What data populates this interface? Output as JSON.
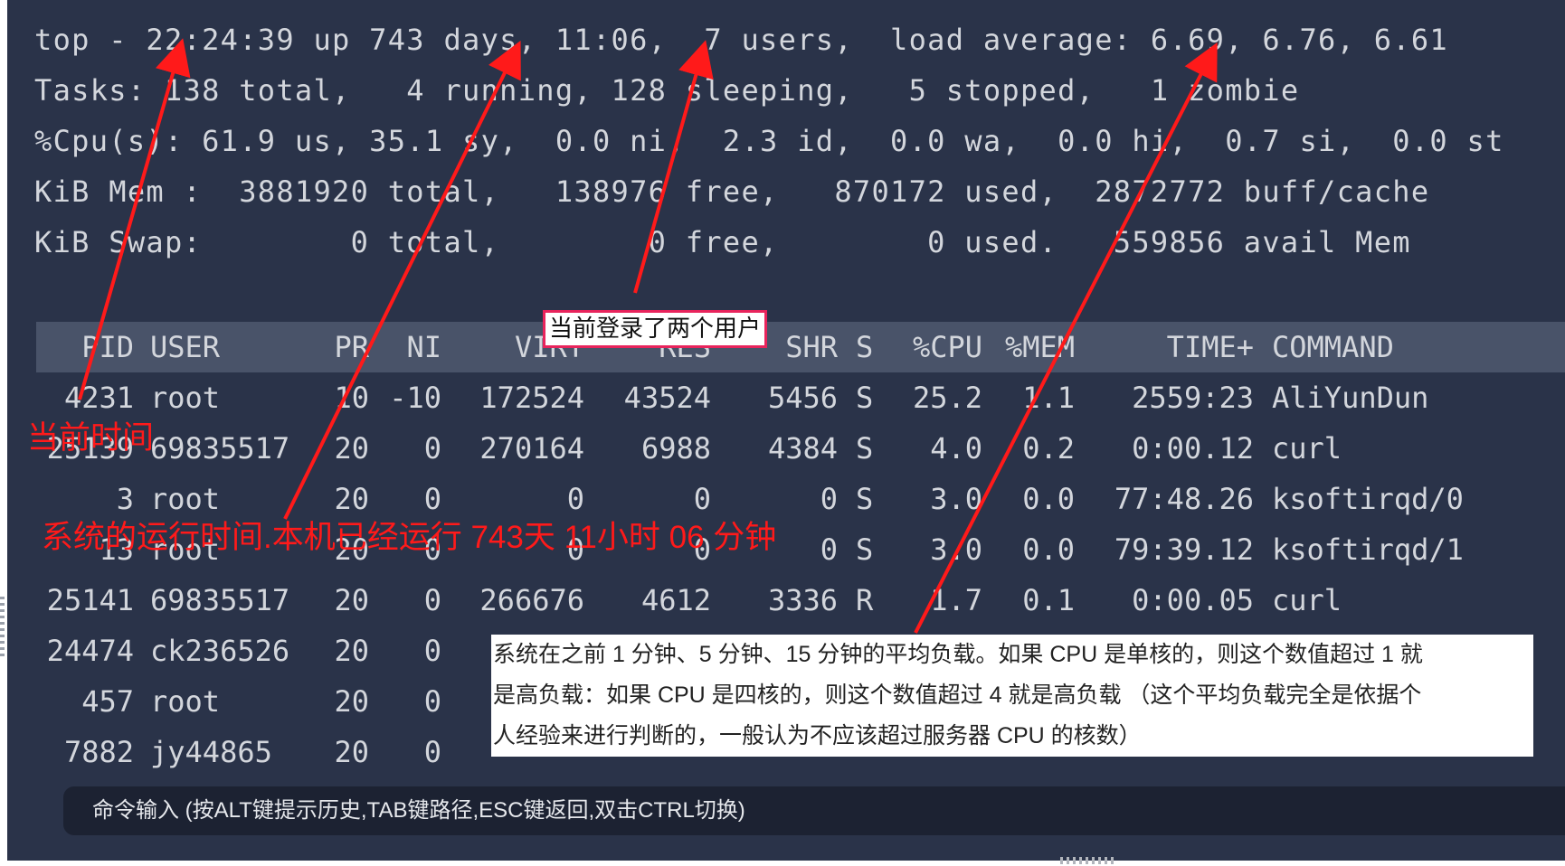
{
  "summary": [
    "top - 22:24:39 up 743 days, 11:06,  7 users,  load average: 6.69, 6.76, 6.61",
    "Tasks: 138 total,   4 running, 128 sleeping,   5 stopped,   1 zombie",
    "%Cpu(s): 61.9 us, 35.1 sy,  0.0 ni,  2.3 id,  0.0 wa,  0.0 hi,  0.7 si,  0.0 st",
    "KiB Mem :  3881920 total,   138976 free,   870172 used,  2872772 buff/cache",
    "KiB Swap:        0 total,        0 free,        0 used.   559856 avail Mem"
  ],
  "table": {
    "headers": [
      "PID",
      "USER",
      "PR",
      "NI",
      "VIRT",
      "RES",
      "SHR",
      "S",
      "%CPU",
      "%MEM",
      "TIME+",
      "COMMAND"
    ],
    "rows": [
      [
        "4231",
        "root",
        "10",
        "-10",
        "172524",
        "43524",
        "5456",
        "S",
        "25.2",
        "1.1",
        "2559:23",
        "AliYunDun"
      ],
      [
        "25139",
        "69835517",
        "20",
        "0",
        "270164",
        "6988",
        "4384",
        "S",
        "4.0",
        "0.2",
        "0:00.12",
        "curl"
      ],
      [
        "3",
        "root",
        "20",
        "0",
        "0",
        "0",
        "0",
        "S",
        "3.0",
        "0.0",
        "77:48.26",
        "ksoftirqd/0"
      ],
      [
        "13",
        "root",
        "20",
        "0",
        "0",
        "0",
        "0",
        "S",
        "3.0",
        "0.0",
        "79:39.12",
        "ksoftirqd/1"
      ],
      [
        "25141",
        "69835517",
        "20",
        "0",
        "266676",
        "4612",
        "3336",
        "R",
        "1.7",
        "0.1",
        "0:00.05",
        "curl"
      ],
      [
        "24474",
        "ck236526",
        "20",
        "0",
        "",
        "",
        "",
        "",
        "",
        "",
        "",
        ""
      ],
      [
        "457",
        "root",
        "20",
        "0",
        "",
        "",
        "",
        "",
        "",
        "",
        "",
        ""
      ],
      [
        "7882",
        "jy44865",
        "20",
        "0",
        "",
        "",
        "",
        "",
        "",
        "",
        "",
        ""
      ]
    ]
  },
  "annotations": {
    "current_time": "当前时间",
    "uptime": "系统的运行时间.本机已经运行 743天 11小时 06 分钟",
    "users": "当前登录了两个用户",
    "load_lines": [
      "系统在之前 1 分钟、5 分钟、15 分钟的平均负载。如果 CPU 是单核的，则这个数值超过 1 就",
      "是高负载：如果 CPU 是四核的，则这个数值超过 4 就是高负载 （这个平均负载完全是依据个",
      "人经验来进行判断的，一般认为不应该超过服务器 CPU 的核数）"
    ]
  },
  "command_bar": {
    "hint": "命令输入 (按ALT键提示历史,TAB键路径,ESC键返回,双击CTRL切换)"
  },
  "colors": {
    "terminal_bg": "#2a3349",
    "header_bg": "#495369",
    "text": "#d3d6dc",
    "annotation_red": "#ff1a1a",
    "box_border": "#e8245c"
  }
}
